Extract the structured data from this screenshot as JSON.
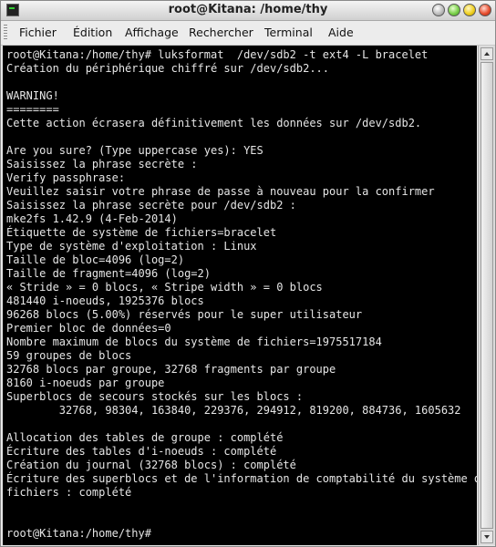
{
  "window": {
    "title": "root@Kitana: /home/thy"
  },
  "menu": [
    "Fichier",
    "Édition",
    "Affichage",
    "Rechercher",
    "Terminal",
    "Aide"
  ],
  "terminal": {
    "lines": [
      "root@Kitana:/home/thy# luksformat  /dev/sdb2 -t ext4 -L bracelet",
      "Création du périphérique chiffré sur /dev/sdb2...",
      "",
      "WARNING!",
      "========",
      "Cette action écrasera définitivement les données sur /dev/sdb2.",
      "",
      "Are you sure? (Type uppercase yes): YES",
      "Saisissez la phrase secrète :",
      "Verify passphrase:",
      "Veuillez saisir votre phrase de passe à nouveau pour la confirmer",
      "Saisissez la phrase secrète pour /dev/sdb2 :",
      "mke2fs 1.42.9 (4-Feb-2014)",
      "Étiquette de système de fichiers=bracelet",
      "Type de système d'exploitation : Linux",
      "Taille de bloc=4096 (log=2)",
      "Taille de fragment=4096 (log=2)",
      "« Stride » = 0 blocs, « Stripe width » = 0 blocs",
      "481440 i-noeuds, 1925376 blocs",
      "96268 blocs (5.00%) réservés pour le super utilisateur",
      "Premier bloc de données=0",
      "Nombre maximum de blocs du système de fichiers=1975517184",
      "59 groupes de blocs",
      "32768 blocs par groupe, 32768 fragments par groupe",
      "8160 i-noeuds par groupe",
      "Superblocs de secours stockés sur les blocs :",
      "        32768, 98304, 163840, 229376, 294912, 819200, 884736, 1605632",
      "",
      "Allocation des tables de groupe : complété",
      "Écriture des tables d'i-noeuds : complété",
      "Création du journal (32768 blocs) : complété",
      "Écriture des superblocs et de l'information de comptabilité du système de",
      "fichiers : complété",
      "",
      "",
      "root@Kitana:/home/thy#"
    ]
  }
}
